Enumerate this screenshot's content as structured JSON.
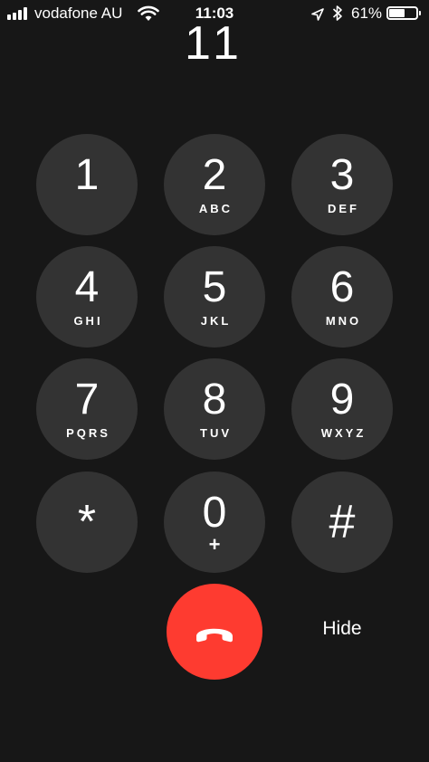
{
  "status_bar": {
    "carrier": "vodafone AU",
    "time": "11:03",
    "battery_percent": "61%",
    "battery_level": 0.61,
    "signal_bars": 4,
    "icons": [
      "signal-icon",
      "wifi-icon",
      "location-icon",
      "bluetooth-icon",
      "battery-icon"
    ]
  },
  "dialer": {
    "display_number": "11",
    "keys": [
      {
        "digit": "1",
        "letters": ""
      },
      {
        "digit": "2",
        "letters": "ABC"
      },
      {
        "digit": "3",
        "letters": "DEF"
      },
      {
        "digit": "4",
        "letters": "GHI"
      },
      {
        "digit": "5",
        "letters": "JKL"
      },
      {
        "digit": "6",
        "letters": "MNO"
      },
      {
        "digit": "7",
        "letters": "PQRS"
      },
      {
        "digit": "8",
        "letters": "TUV"
      },
      {
        "digit": "9",
        "letters": "WXYZ"
      },
      {
        "digit": "*",
        "letters": ""
      },
      {
        "digit": "0",
        "letters": "+"
      },
      {
        "digit": "#",
        "letters": ""
      }
    ],
    "end_call_icon": "phone-hangup-icon",
    "hide_label": "Hide"
  },
  "colors": {
    "background": "#171717",
    "key": "#333333",
    "end_call": "#fe3b30",
    "text": "#ffffff"
  }
}
